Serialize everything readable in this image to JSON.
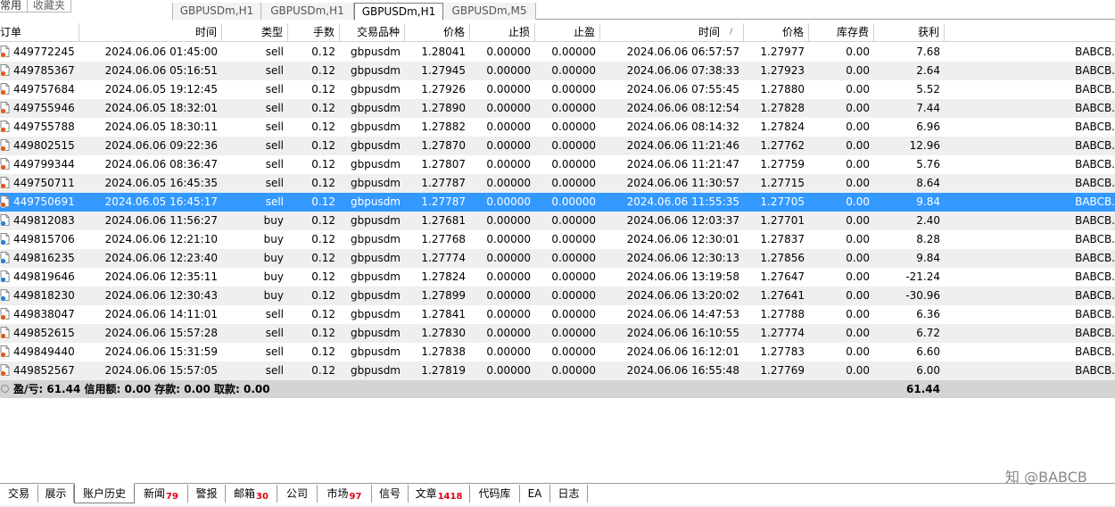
{
  "top": {
    "left_tabs": [
      "常用",
      "收藏夹"
    ],
    "chart_tabs": [
      {
        "label": "GBPUSDm,H1",
        "active": false
      },
      {
        "label": "GBPUSDm,H1",
        "active": false
      },
      {
        "label": "GBPUSDm,H1",
        "active": true
      },
      {
        "label": "GBPUSDm,M5",
        "active": false
      }
    ]
  },
  "table": {
    "columns": [
      "订单",
      "时间",
      "类型",
      "手数",
      "交易品种",
      "价格",
      "止损",
      "止盈",
      "时间",
      "价格",
      "库存费",
      "获利"
    ],
    "sort_indicator": "/",
    "rows": [
      {
        "ticket": "449772245",
        "open_time": "2024.06.06 01:45:00",
        "type": "sell",
        "lots": "0.12",
        "symbol": "gbpusdm",
        "open_price": "1.28041",
        "sl": "0.00000",
        "tp": "0.00000",
        "close_time": "2024.06.06 06:57:57",
        "close_price": "1.27977",
        "swap": "0.00",
        "profit": "7.68",
        "comment": "BABCB."
      },
      {
        "ticket": "449785367",
        "open_time": "2024.06.06 05:16:51",
        "type": "sell",
        "lots": "0.12",
        "symbol": "gbpusdm",
        "open_price": "1.27945",
        "sl": "0.00000",
        "tp": "0.00000",
        "close_time": "2024.06.06 07:38:33",
        "close_price": "1.27923",
        "swap": "0.00",
        "profit": "2.64",
        "comment": "BABCB."
      },
      {
        "ticket": "449757684",
        "open_time": "2024.06.05 19:12:45",
        "type": "sell",
        "lots": "0.12",
        "symbol": "gbpusdm",
        "open_price": "1.27926",
        "sl": "0.00000",
        "tp": "0.00000",
        "close_time": "2024.06.06 07:55:45",
        "close_price": "1.27880",
        "swap": "0.00",
        "profit": "5.52",
        "comment": "BABCB."
      },
      {
        "ticket": "449755946",
        "open_time": "2024.06.05 18:32:01",
        "type": "sell",
        "lots": "0.12",
        "symbol": "gbpusdm",
        "open_price": "1.27890",
        "sl": "0.00000",
        "tp": "0.00000",
        "close_time": "2024.06.06 08:12:54",
        "close_price": "1.27828",
        "swap": "0.00",
        "profit": "7.44",
        "comment": "BABCB."
      },
      {
        "ticket": "449755788",
        "open_time": "2024.06.05 18:30:11",
        "type": "sell",
        "lots": "0.12",
        "symbol": "gbpusdm",
        "open_price": "1.27882",
        "sl": "0.00000",
        "tp": "0.00000",
        "close_time": "2024.06.06 08:14:32",
        "close_price": "1.27824",
        "swap": "0.00",
        "profit": "6.96",
        "comment": "BABCB."
      },
      {
        "ticket": "449802515",
        "open_time": "2024.06.06 09:22:36",
        "type": "sell",
        "lots": "0.12",
        "symbol": "gbpusdm",
        "open_price": "1.27870",
        "sl": "0.00000",
        "tp": "0.00000",
        "close_time": "2024.06.06 11:21:46",
        "close_price": "1.27762",
        "swap": "0.00",
        "profit": "12.96",
        "comment": "BABCB."
      },
      {
        "ticket": "449799344",
        "open_time": "2024.06.06 08:36:47",
        "type": "sell",
        "lots": "0.12",
        "symbol": "gbpusdm",
        "open_price": "1.27807",
        "sl": "0.00000",
        "tp": "0.00000",
        "close_time": "2024.06.06 11:21:47",
        "close_price": "1.27759",
        "swap": "0.00",
        "profit": "5.76",
        "comment": "BABCB."
      },
      {
        "ticket": "449750711",
        "open_time": "2024.06.05 16:45:35",
        "type": "sell",
        "lots": "0.12",
        "symbol": "gbpusdm",
        "open_price": "1.27787",
        "sl": "0.00000",
        "tp": "0.00000",
        "close_time": "2024.06.06 11:30:57",
        "close_price": "1.27715",
        "swap": "0.00",
        "profit": "8.64",
        "comment": "BABCB."
      },
      {
        "ticket": "449750691",
        "open_time": "2024.06.05 16:45:17",
        "type": "sell",
        "lots": "0.12",
        "symbol": "gbpusdm",
        "open_price": "1.27787",
        "sl": "0.00000",
        "tp": "0.00000",
        "close_time": "2024.06.06 11:55:35",
        "close_price": "1.27705",
        "swap": "0.00",
        "profit": "9.84",
        "comment": "BABCB.",
        "selected": true
      },
      {
        "ticket": "449812083",
        "open_time": "2024.06.06 11:56:27",
        "type": "buy",
        "lots": "0.12",
        "symbol": "gbpusdm",
        "open_price": "1.27681",
        "sl": "0.00000",
        "tp": "0.00000",
        "close_time": "2024.06.06 12:03:37",
        "close_price": "1.27701",
        "swap": "0.00",
        "profit": "2.40",
        "comment": "BABCB."
      },
      {
        "ticket": "449815706",
        "open_time": "2024.06.06 12:21:10",
        "type": "buy",
        "lots": "0.12",
        "symbol": "gbpusdm",
        "open_price": "1.27768",
        "sl": "0.00000",
        "tp": "0.00000",
        "close_time": "2024.06.06 12:30:01",
        "close_price": "1.27837",
        "swap": "0.00",
        "profit": "8.28",
        "comment": "BABCB."
      },
      {
        "ticket": "449816235",
        "open_time": "2024.06.06 12:23:40",
        "type": "buy",
        "lots": "0.12",
        "symbol": "gbpusdm",
        "open_price": "1.27774",
        "sl": "0.00000",
        "tp": "0.00000",
        "close_time": "2024.06.06 12:30:13",
        "close_price": "1.27856",
        "swap": "0.00",
        "profit": "9.84",
        "comment": "BABCB."
      },
      {
        "ticket": "449819646",
        "open_time": "2024.06.06 12:35:11",
        "type": "buy",
        "lots": "0.12",
        "symbol": "gbpusdm",
        "open_price": "1.27824",
        "sl": "0.00000",
        "tp": "0.00000",
        "close_time": "2024.06.06 13:19:58",
        "close_price": "1.27647",
        "swap": "0.00",
        "profit": "-21.24",
        "comment": "BABCB."
      },
      {
        "ticket": "449818230",
        "open_time": "2024.06.06 12:30:43",
        "type": "buy",
        "lots": "0.12",
        "symbol": "gbpusdm",
        "open_price": "1.27899",
        "sl": "0.00000",
        "tp": "0.00000",
        "close_time": "2024.06.06 13:20:02",
        "close_price": "1.27641",
        "swap": "0.00",
        "profit": "-30.96",
        "comment": "BABCB."
      },
      {
        "ticket": "449838047",
        "open_time": "2024.06.06 14:11:01",
        "type": "sell",
        "lots": "0.12",
        "symbol": "gbpusdm",
        "open_price": "1.27841",
        "sl": "0.00000",
        "tp": "0.00000",
        "close_time": "2024.06.06 14:47:53",
        "close_price": "1.27788",
        "swap": "0.00",
        "profit": "6.36",
        "comment": "BABCB."
      },
      {
        "ticket": "449852615",
        "open_time": "2024.06.06 15:57:28",
        "type": "sell",
        "lots": "0.12",
        "symbol": "gbpusdm",
        "open_price": "1.27830",
        "sl": "0.00000",
        "tp": "0.00000",
        "close_time": "2024.06.06 16:10:55",
        "close_price": "1.27774",
        "swap": "0.00",
        "profit": "6.72",
        "comment": "BABCB."
      },
      {
        "ticket": "449849440",
        "open_time": "2024.06.06 15:31:59",
        "type": "sell",
        "lots": "0.12",
        "symbol": "gbpusdm",
        "open_price": "1.27838",
        "sl": "0.00000",
        "tp": "0.00000",
        "close_time": "2024.06.06 16:12:01",
        "close_price": "1.27783",
        "swap": "0.00",
        "profit": "6.60",
        "comment": "BABCB."
      },
      {
        "ticket": "449852567",
        "open_time": "2024.06.06 15:57:05",
        "type": "sell",
        "lots": "0.12",
        "symbol": "gbpusdm",
        "open_price": "1.27819",
        "sl": "0.00000",
        "tp": "0.00000",
        "close_time": "2024.06.06 16:55:48",
        "close_price": "1.27769",
        "swap": "0.00",
        "profit": "6.00",
        "comment": "BABCB."
      }
    ],
    "summary": {
      "text": "盈/亏: 61.44  信用额: 0.00  存款: 0.00  取款: 0.00",
      "total": "61.44"
    }
  },
  "bottom_tabs": [
    {
      "label": "交易",
      "badge": ""
    },
    {
      "label": "展示",
      "badge": ""
    },
    {
      "label": "账户历史",
      "badge": "",
      "active": true
    },
    {
      "label": "新闻",
      "badge": "79"
    },
    {
      "label": "警报",
      "badge": ""
    },
    {
      "label": "邮箱",
      "badge": "30"
    },
    {
      "label": "公司",
      "badge": ""
    },
    {
      "label": "市场",
      "badge": "97"
    },
    {
      "label": "信号",
      "badge": ""
    },
    {
      "label": "文章",
      "badge": "1418"
    },
    {
      "label": "代码库",
      "badge": ""
    },
    {
      "label": "EA",
      "badge": ""
    },
    {
      "label": "日志",
      "badge": ""
    }
  ],
  "watermark": "知 @BABCB",
  "colors": {
    "selected_row": "#3399ff",
    "alt_row": "#efefef",
    "summary_bg": "#d4d4d4",
    "badge": "#e0001a",
    "sell_icon": "#e05a1b",
    "buy_icon": "#2a7fd4"
  }
}
